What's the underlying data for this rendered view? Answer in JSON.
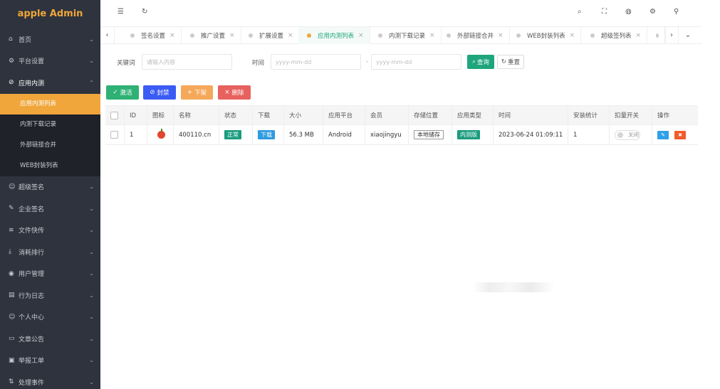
{
  "app": {
    "title": "apple Admin"
  },
  "sidebar": {
    "items": [
      {
        "label": "首页",
        "icon": "home-icon",
        "glyph": "⌂"
      },
      {
        "label": "平台设置",
        "icon": "gear-icon",
        "glyph": "⚙"
      },
      {
        "label": "应用内测",
        "icon": "link-icon",
        "glyph": "⊘"
      },
      {
        "label": "超级签名",
        "icon": "smile-icon",
        "glyph": "☺"
      },
      {
        "label": "企业签名",
        "icon": "edit-icon",
        "glyph": "✎"
      },
      {
        "label": "文件快传",
        "icon": "stack-icon",
        "glyph": "≋"
      },
      {
        "label": "消耗排行",
        "icon": "download-icon",
        "glyph": "⤓"
      },
      {
        "label": "用户管理",
        "icon": "user-icon",
        "glyph": "◉"
      },
      {
        "label": "行为日志",
        "icon": "file-icon",
        "glyph": "▤"
      },
      {
        "label": "个人中心",
        "icon": "face-icon",
        "glyph": "☺"
      },
      {
        "label": "文章公告",
        "icon": "monitor-icon",
        "glyph": "▭"
      },
      {
        "label": "举报工单",
        "icon": "ticket-icon",
        "glyph": "▣"
      },
      {
        "label": "处理事件",
        "icon": "flow-icon",
        "glyph": "⇅"
      }
    ],
    "submenu": [
      "应用内测列表",
      "内测下载记录",
      "外部链接合并",
      "WEB封装列表"
    ]
  },
  "tabs": [
    {
      "label": "签名设置"
    },
    {
      "label": "推广设置"
    },
    {
      "label": "扩展设置"
    },
    {
      "label": "应用内测列表"
    },
    {
      "label": "内测下载记录"
    },
    {
      "label": "外部链接合并"
    },
    {
      "label": "WEB封装列表"
    },
    {
      "label": "超级签列表"
    }
  ],
  "search": {
    "keyword_label": "关键词",
    "keyword_placeholder": "请输入内容",
    "time_label": "时间",
    "date_placeholder_start": "yyyy-mm-dd",
    "date_sep": "-",
    "date_placeholder_end": "yyyy-mm-dd",
    "search_btn": "查询",
    "reset_btn": "重置"
  },
  "actions": {
    "activate": "激活",
    "ban": "封禁",
    "offline": "下架",
    "delete": "删除"
  },
  "table": {
    "headers": [
      "ID",
      "图标",
      "名称",
      "状态",
      "下载",
      "大小",
      "应用平台",
      "会员",
      "存储位置",
      "应用类型",
      "时间",
      "安装统计",
      "扣量开关",
      "操作"
    ],
    "rows": [
      {
        "id": "1",
        "name": "400110.cn",
        "status": "正常",
        "download": "下载",
        "size": "56.3 MB",
        "platform": "Android",
        "member": "xiaojingyu",
        "storage": "本地储存",
        "type": "内测版",
        "time": "2023-06-24 01:09:11",
        "installs": "1",
        "toggle": "关闭"
      }
    ]
  },
  "colors": {
    "sidebar_bg": "#2e333d",
    "accent": "#f0a63a",
    "primary_green": "#1fa57b"
  }
}
